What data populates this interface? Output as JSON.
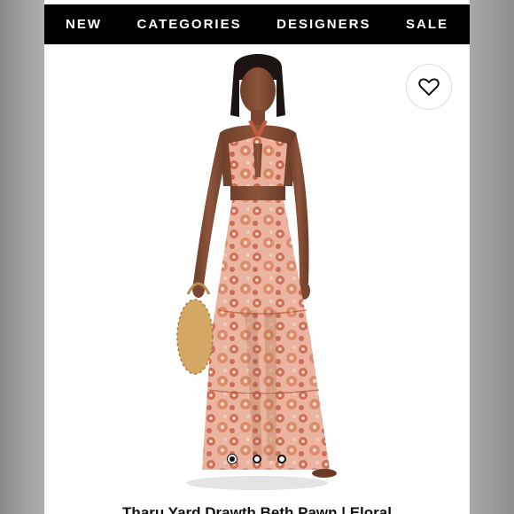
{
  "nav": {
    "items": [
      {
        "label": "NEW"
      },
      {
        "label": "CATEGORIES"
      },
      {
        "label": "DESIGNERS"
      },
      {
        "label": "SALE"
      }
    ]
  },
  "product": {
    "image": "model-in-floral-halter-maxi-dress",
    "favorite_icon": "heart-outline-icon",
    "carousel": {
      "total": 3,
      "active": 1
    },
    "title": "Tharu Yard Drawth Beth Pawn | Eloral"
  },
  "colors": {
    "nav_bg": "#000000",
    "nav_text": "#ffffff",
    "dress_base": "#e7a38d",
    "dress_pattern": "#c65a3f"
  }
}
